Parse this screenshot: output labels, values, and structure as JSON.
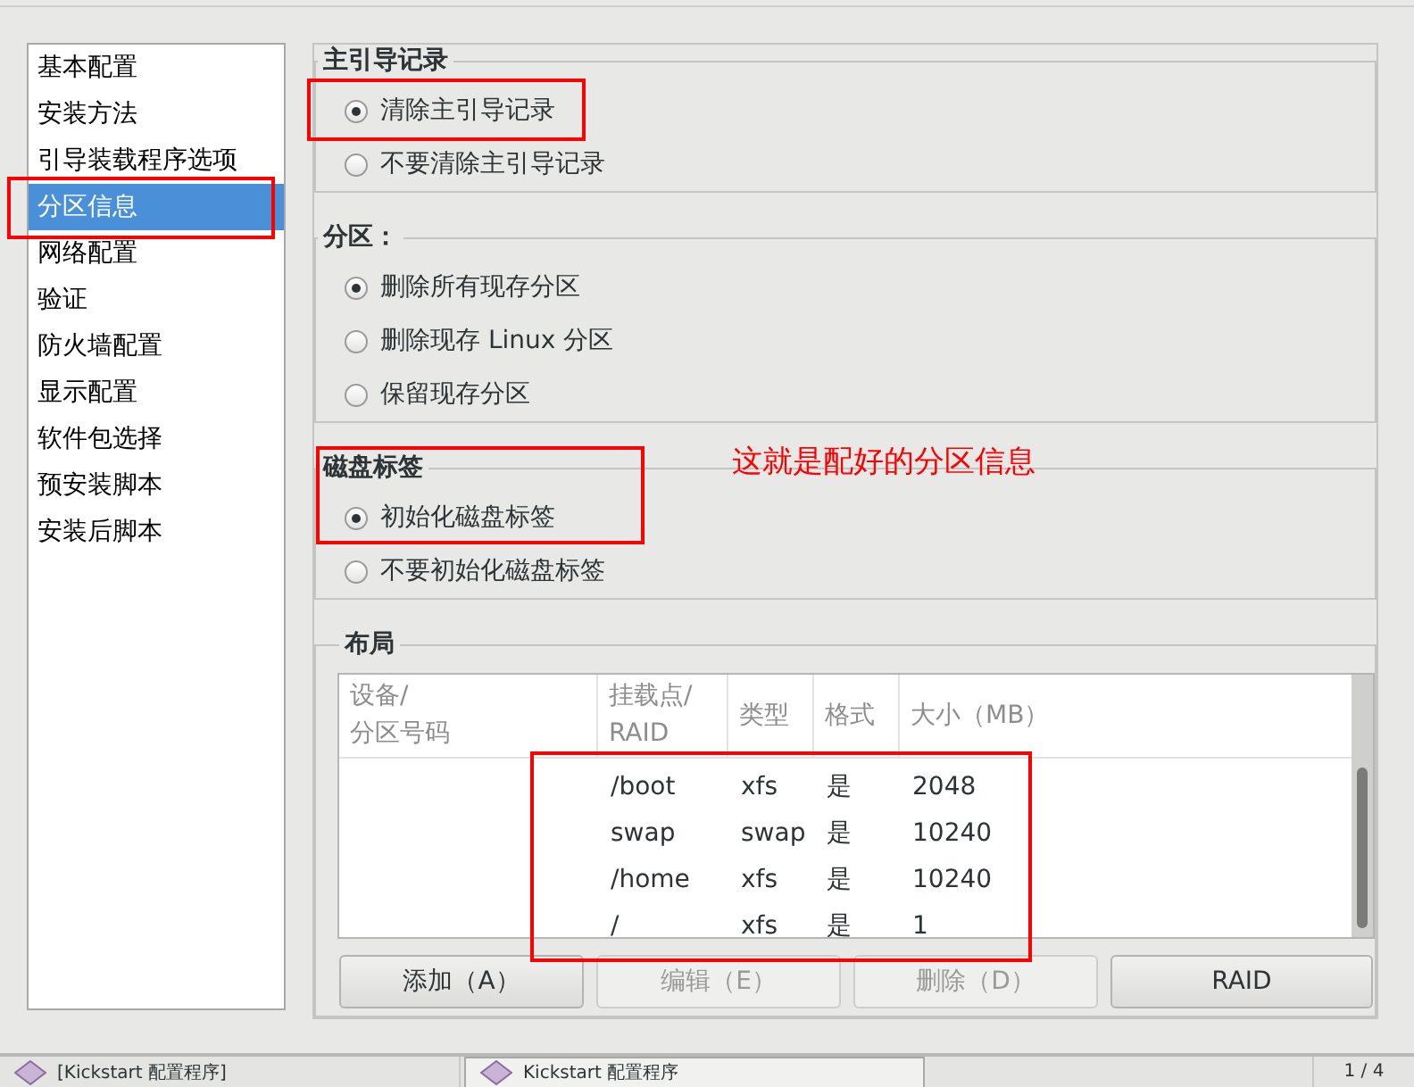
{
  "sidebar": {
    "items": [
      {
        "label": "基本配置",
        "selected": false
      },
      {
        "label": "安装方法",
        "selected": false
      },
      {
        "label": "引导装载程序选项",
        "selected": false
      },
      {
        "label": "分区信息",
        "selected": true
      },
      {
        "label": "网络配置",
        "selected": false
      },
      {
        "label": "验证",
        "selected": false
      },
      {
        "label": "防火墙配置",
        "selected": false
      },
      {
        "label": "显示配置",
        "selected": false
      },
      {
        "label": "软件包选择",
        "selected": false
      },
      {
        "label": "预安装脚本",
        "selected": false
      },
      {
        "label": "安装后脚本",
        "selected": false
      }
    ]
  },
  "panel": {
    "sections": [
      {
        "kind": "radio",
        "title": "主引导记录",
        "options": [
          {
            "label": "清除主引导记录",
            "selected": true
          },
          {
            "label": "不要清除主引导记录",
            "selected": false
          }
        ]
      },
      {
        "kind": "radio",
        "title": "分区：",
        "options": [
          {
            "label": "删除所有现存分区",
            "selected": true
          },
          {
            "label": "删除现存 Linux 分区",
            "selected": false
          },
          {
            "label": "保留现存分区",
            "selected": false
          }
        ]
      },
      {
        "kind": "radio",
        "title": "磁盘标签",
        "options": [
          {
            "label": "初始化磁盘标签",
            "selected": true
          },
          {
            "label": "不要初始化磁盘标签",
            "selected": false
          }
        ]
      },
      {
        "kind": "table",
        "title": "布局",
        "table": {
          "columns": [
            "设备/\n分区号码",
            "挂载点/\nRAID",
            "类型",
            "格式",
            "大小（MB）"
          ],
          "rows": [
            {
              "mount_point": "/boot",
              "type": "xfs",
              "format": "是",
              "size": "2048"
            },
            {
              "mount_point": "swap",
              "type": "swap",
              "format": "是",
              "size": "10240"
            },
            {
              "mount_point": "/home",
              "type": "xfs",
              "format": "是",
              "size": "10240"
            },
            {
              "mount_point": "/",
              "type": "xfs",
              "format": "是",
              "size": "1"
            }
          ]
        },
        "buttons": [
          {
            "label": "添加（A）",
            "disabled": false
          },
          {
            "label": "编辑（E）",
            "disabled": true
          },
          {
            "label": "删除（D）",
            "disabled": true
          },
          {
            "label": "RAID",
            "disabled": false
          }
        ]
      }
    ]
  },
  "annotation": {
    "text": "这就是配好的分区信息"
  },
  "taskbar": {
    "tasks": [
      {
        "label": "[Kickstart 配置程序]",
        "selected": false
      },
      {
        "label": "Kickstart 配置程序",
        "selected": true
      }
    ],
    "pager": "1 / 4"
  }
}
